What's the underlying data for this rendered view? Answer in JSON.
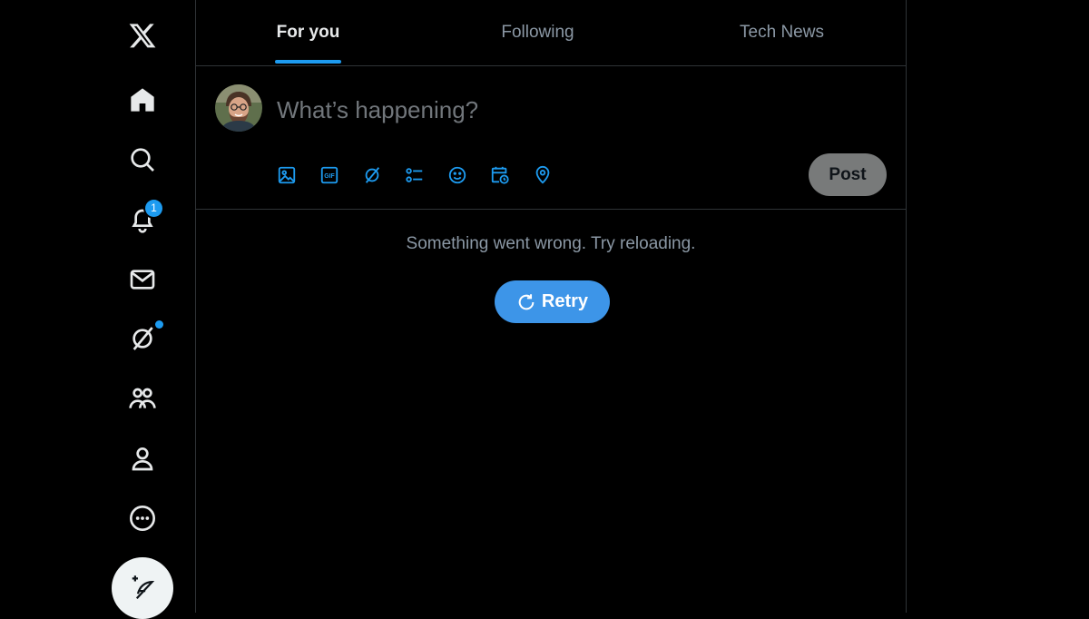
{
  "nav": {
    "items": [
      {
        "name": "x-logo-icon"
      },
      {
        "name": "home-icon"
      },
      {
        "name": "explore-icon"
      },
      {
        "name": "notifications-icon"
      },
      {
        "name": "messages-icon"
      },
      {
        "name": "grok-icon"
      },
      {
        "name": "communities-icon"
      },
      {
        "name": "profile-icon"
      },
      {
        "name": "more-icon"
      }
    ],
    "notifications_badge": "1",
    "compose_icon": "feather-plus-icon"
  },
  "tabs": [
    {
      "label": "For you",
      "active": true
    },
    {
      "label": "Following",
      "active": false
    },
    {
      "label": "Tech News",
      "active": false
    }
  ],
  "composer": {
    "placeholder": "What’s happening?",
    "tools": [
      "media-icon",
      "gif-icon",
      "grok-icon",
      "poll-icon",
      "emoji-icon",
      "schedule-icon",
      "location-icon"
    ],
    "post_label": "Post"
  },
  "feed": {
    "error_message": "Something went wrong. Try reloading.",
    "retry_label": "Retry"
  },
  "colors": {
    "accent": "#1d9bf0",
    "retry_button": "#3d95e8",
    "background": "#000000",
    "border": "#2f3336",
    "secondary_text": "#8b98a5",
    "post_button_disabled": "#787a7a"
  }
}
